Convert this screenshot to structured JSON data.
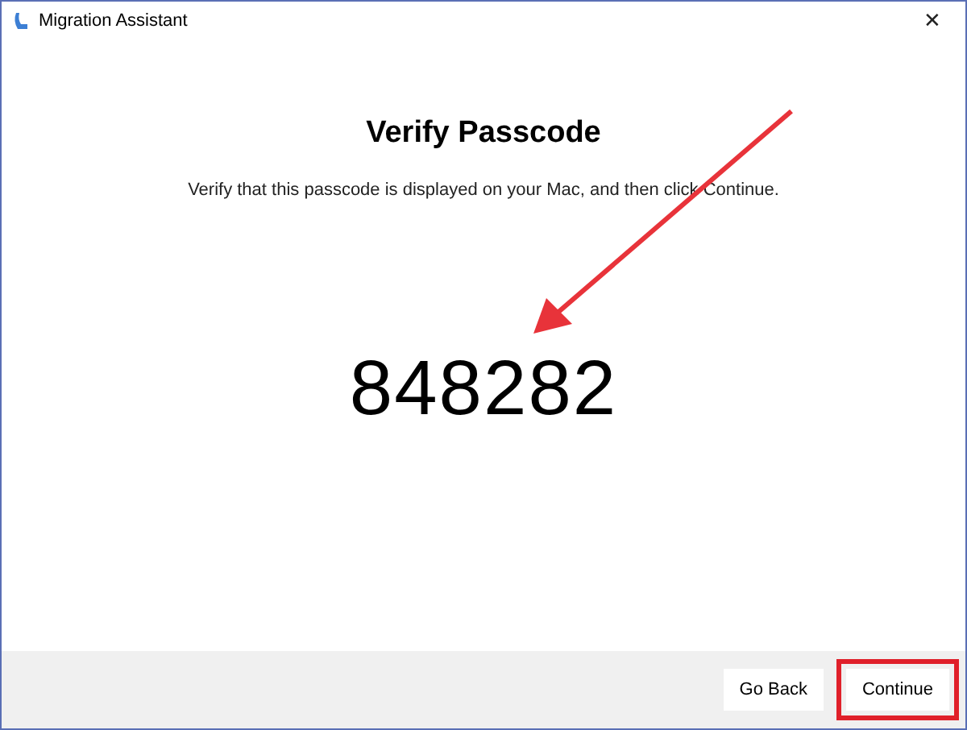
{
  "window": {
    "title": "Migration Assistant",
    "close": "✕"
  },
  "heading": "Verify Passcode",
  "instruction": "Verify that this passcode is displayed on your Mac, and then click Continue.",
  "passcode": "848282",
  "buttons": [
    {
      "label": "Go Back",
      "highlighted": false
    },
    {
      "label": "Continue",
      "highlighted": true
    }
  ]
}
